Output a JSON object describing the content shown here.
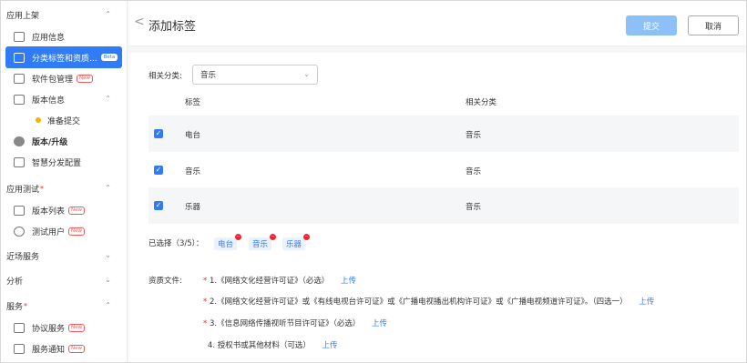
{
  "sidebar": {
    "sections": [
      {
        "label": "应用上架",
        "chev": "^"
      },
      {
        "label": "应用测试",
        "chev": "^",
        "required": "*"
      },
      {
        "label": "近场服务",
        "chev": "v"
      },
      {
        "label": "分析",
        "chev": "v"
      },
      {
        "label": "服务",
        "chev": "^",
        "required": "*"
      }
    ],
    "items": [
      {
        "label": "应用信息"
      },
      {
        "label": "分类标签和资质...",
        "badge": "Beta"
      },
      {
        "label": "软件包管理",
        "badge": "New"
      },
      {
        "label": "版本信息"
      },
      {
        "label": "准备提交"
      },
      {
        "label": "版本/升级"
      },
      {
        "label": "智慧分发配置"
      },
      {
        "label": "版本列表",
        "badge": "New"
      },
      {
        "label": "测试用户",
        "badge": "New"
      },
      {
        "label": "协议服务",
        "badge": "New"
      },
      {
        "label": "服务通知",
        "badge": "New"
      }
    ]
  },
  "header": {
    "back_icon": "<",
    "title": "添加标签",
    "submit": "提交",
    "cancel": "取消"
  },
  "main": {
    "category_label": "相关分类:",
    "category_value": "音乐",
    "table": {
      "headers": [
        "标签",
        "相关分类"
      ],
      "rows": [
        {
          "tag": "电台",
          "category": "音乐",
          "checked": true
        },
        {
          "tag": "音乐",
          "category": "音乐",
          "checked": true
        },
        {
          "tag": "乐器",
          "category": "音乐",
          "checked": true
        }
      ]
    },
    "selected_label": "已选择（3/5）：",
    "selected_chips": [
      "电台",
      "音乐",
      "乐器"
    ],
    "docs_label": "资质文件:",
    "docs": [
      {
        "star": "*",
        "text": "1.《网络文化经营许可证》（必选）",
        "link": "上传"
      },
      {
        "star": "*",
        "text": "2.《网络文化经营许可证》或《有线电视台许可证》或《广播电视播出机构许可证》或《广播电视频道许可证》。（四选一）",
        "link": "上传"
      },
      {
        "star": "*",
        "text": "3.《信息网络传播视听节目许可证》（必选）",
        "link": "上传"
      },
      {
        "star": "",
        "text": "4. 授权书或其他材料（可选）",
        "link": "上传"
      }
    ]
  },
  "colors": {
    "accent": "#2f7cf6",
    "submit_disabled": "#8ec0f8",
    "required": "#f5222d"
  }
}
